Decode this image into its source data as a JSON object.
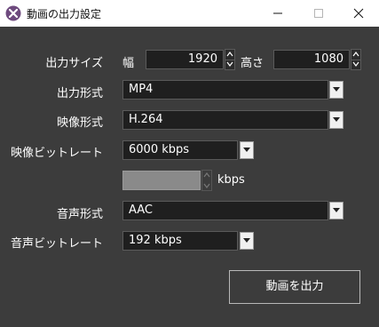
{
  "window": {
    "title": "動画の出力設定"
  },
  "output_size": {
    "label": "出力サイズ",
    "width_label": "幅",
    "width_value": "1920",
    "height_label": "高さ",
    "height_value": "1080"
  },
  "output_format": {
    "label": "出力形式",
    "value": "MP4"
  },
  "video_format": {
    "label": "映像形式",
    "value": "H.264"
  },
  "video_bitrate": {
    "label": "映像ビットレート",
    "value": "6000 kbps",
    "custom_unit": "kbps"
  },
  "audio_format": {
    "label": "音声形式",
    "value": "AAC"
  },
  "audio_bitrate": {
    "label": "音声ビットレート",
    "value": "192 kbps"
  },
  "export_button": {
    "label": "動画を出力"
  },
  "colors": {
    "background": "#3c3c3c",
    "field": "#1f1f1f",
    "titlebar": "#ffffff",
    "app_icon": "#6e4a7e"
  }
}
